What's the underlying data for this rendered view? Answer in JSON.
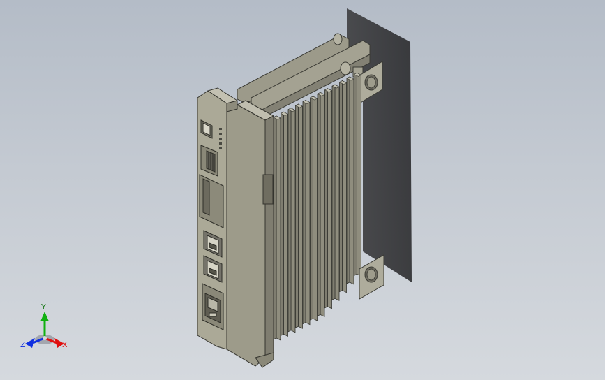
{
  "triad": {
    "x_label": "X",
    "y_label": "Y",
    "z_label": "Z",
    "x_color": "#e01010",
    "y_color": "#10b010",
    "z_color": "#1030e0"
  },
  "model": {
    "body_color": "#adab9a",
    "heatsink_color": "#8f8d7e",
    "shadow_color": "#2c2c2e"
  }
}
